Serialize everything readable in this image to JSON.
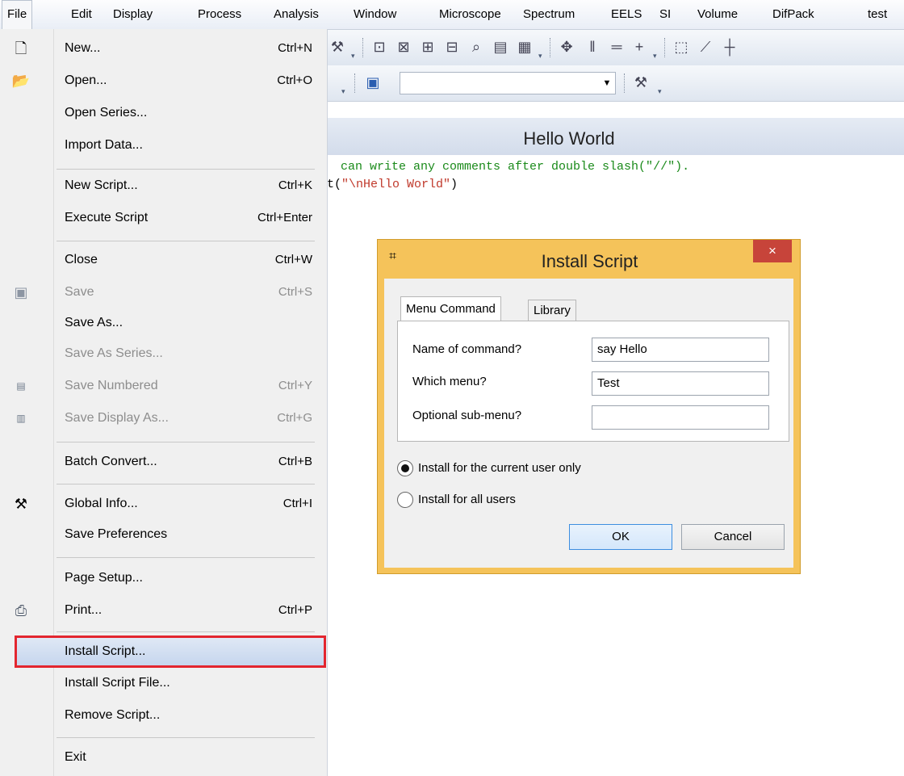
{
  "menubar": {
    "items": [
      "File",
      "Edit",
      "Display",
      "Process",
      "Analysis",
      "Window",
      "Microscope",
      "Spectrum",
      "EELS",
      "SI",
      "Volume",
      "DifPack",
      "test"
    ]
  },
  "window": {
    "title": "Hello World",
    "code_line1": "can write any comments after double slash(\"//\").",
    "code_line2_prefix": "t(",
    "code_line2_string": "\"\\nHello World\"",
    "code_line2_suffix": ")"
  },
  "file_menu": {
    "items": [
      {
        "label": "New...",
        "shortcut": "Ctrl+N",
        "icon": "new-doc-icon"
      },
      {
        "label": "Open...",
        "shortcut": "Ctrl+O",
        "icon": "folder-icon"
      },
      {
        "label": "Open Series...",
        "shortcut": ""
      },
      {
        "label": "Import Data...",
        "shortcut": ""
      },
      {
        "label": "New Script...",
        "shortcut": "Ctrl+K"
      },
      {
        "label": "Execute Script",
        "shortcut": "Ctrl+Enter"
      },
      {
        "label": "Close",
        "shortcut": "Ctrl+W"
      },
      {
        "label": "Save",
        "shortcut": "Ctrl+S",
        "icon": "disk-icon"
      },
      {
        "label": "Save As...",
        "shortcut": ""
      },
      {
        "label": "Save As Series...",
        "shortcut": ""
      },
      {
        "label": "Save Numbered",
        "shortcut": "Ctrl+Y",
        "icon": "numbered-icon"
      },
      {
        "label": "Save Display As...",
        "shortcut": "Ctrl+G",
        "icon": "display-icon"
      },
      {
        "label": "Batch Convert...",
        "shortcut": "Ctrl+B"
      },
      {
        "label": "Global Info...",
        "shortcut": "Ctrl+I",
        "icon": "tools-icon"
      },
      {
        "label": "Save Preferences",
        "shortcut": ""
      },
      {
        "label": "Page Setup...",
        "shortcut": ""
      },
      {
        "label": "Print...",
        "shortcut": "Ctrl+P",
        "icon": "printer-icon"
      },
      {
        "label": "Install Script...",
        "shortcut": ""
      },
      {
        "label": "Install Script File...",
        "shortcut": ""
      },
      {
        "label": "Remove Script...",
        "shortcut": ""
      },
      {
        "label": "Exit",
        "shortcut": ""
      }
    ]
  },
  "dialog": {
    "title": "Install Script",
    "close_label": "×",
    "tabs": [
      "Menu Command",
      "Library"
    ],
    "fields": [
      {
        "label": "Name of command?",
        "value": "say Hello"
      },
      {
        "label": "Which menu?",
        "value": "Test"
      },
      {
        "label": "Optional sub-menu?",
        "value": ""
      }
    ],
    "radios": [
      {
        "label": "Install for the current user only",
        "checked": true
      },
      {
        "label": "Install for all users",
        "checked": false
      }
    ],
    "ok_label": "OK",
    "cancel_label": "Cancel"
  },
  "colors": {
    "highlight_border": "#e3262f",
    "dialog_frame": "#f5c35a",
    "code_green": "#1a8a1a",
    "code_red": "#c0392b"
  }
}
